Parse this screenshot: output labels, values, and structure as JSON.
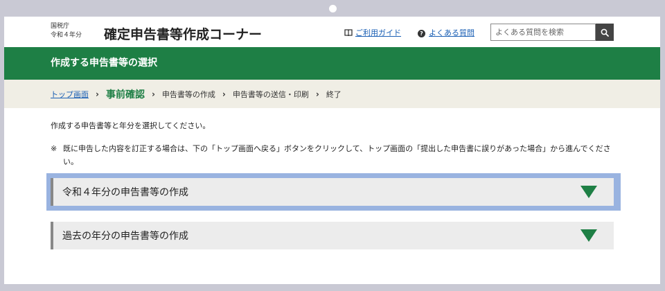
{
  "header": {
    "agency_line1": "国税庁",
    "agency_line2": "令和４年分",
    "site_title": "確定申告書等作成コーナー",
    "guide_link": "ご利用ガイド",
    "faq_link": "よくある質問",
    "search_placeholder": "よくある質問を検索",
    "icons": {
      "guide": "book-icon",
      "faq": "question-circle-icon",
      "search": "search-icon"
    }
  },
  "page_heading": "作成する申告書等の選択",
  "breadcrumb": {
    "items": [
      "トップ画面",
      "事前確認",
      "申告書等の作成",
      "申告書等の送信・印刷",
      "終了"
    ],
    "separator": "›",
    "current_index": 1
  },
  "main": {
    "instruction": "作成する申告書等と年分を選択してください。",
    "note_mark": "※",
    "note_text": "既に申告した内容を訂正する場合は、下の「トップ画面へ戻る」ボタンをクリックして、トップ画面の「提出した申告書に誤りがあった場合」から進んでください。",
    "options": [
      {
        "label": "令和４年分の申告書等の作成"
      },
      {
        "label": "過去の年分の申告書等の作成"
      }
    ]
  },
  "colors": {
    "brand_green": "#1e7f45",
    "breadcrumb_bg": "#f0eee5",
    "link_blue": "#1a5fb4",
    "focus_ring": "#99b3e0",
    "bezel": "#c9c9d4"
  }
}
